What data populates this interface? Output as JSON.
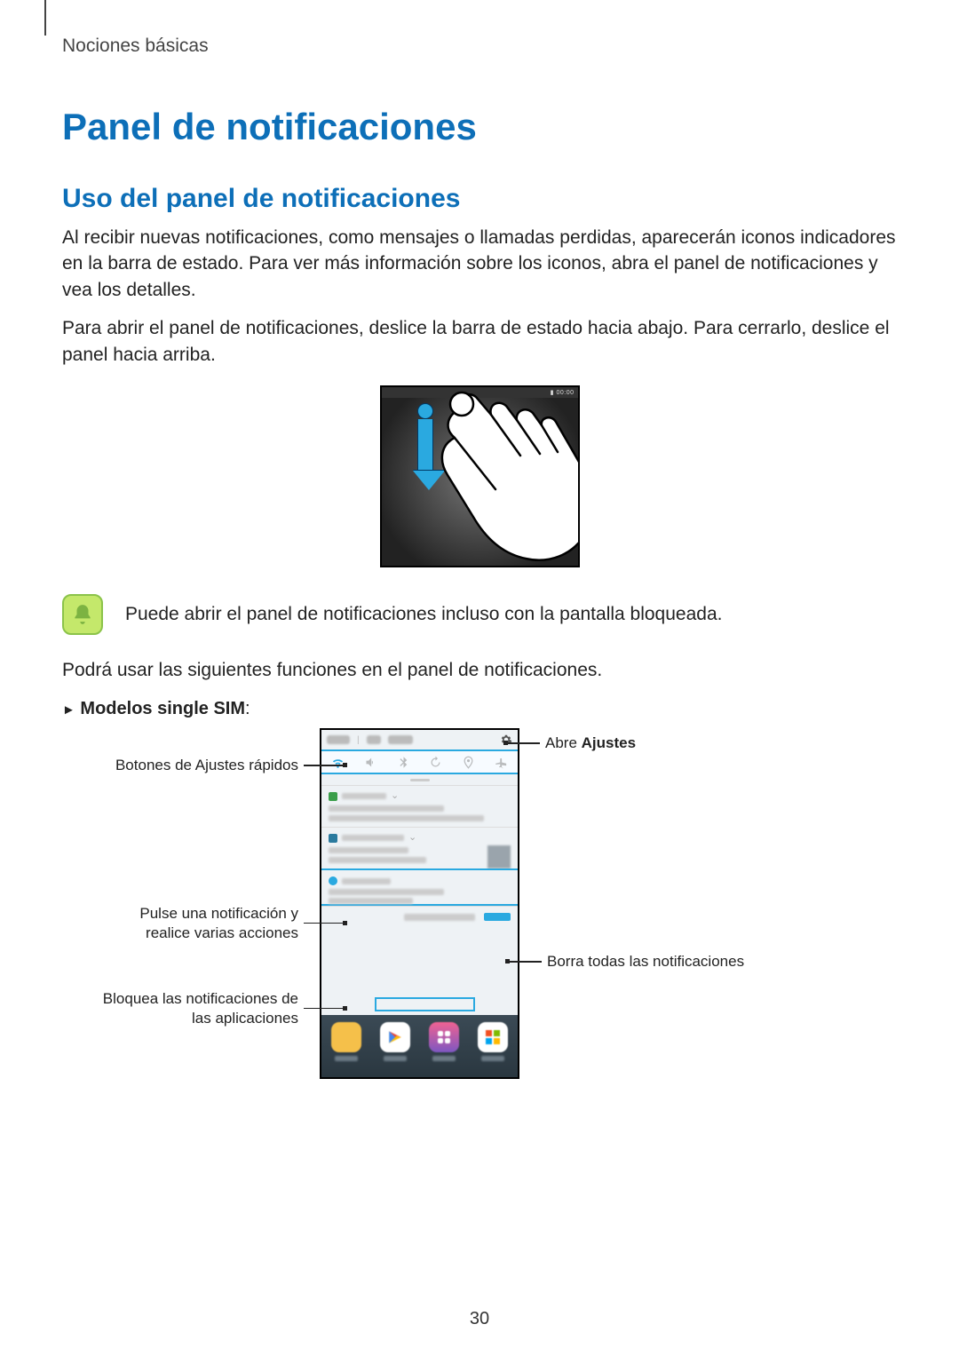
{
  "breadcrumb": "Nociones básicas",
  "title": "Panel de notificaciones",
  "subtitle": "Uso del panel de notificaciones",
  "para1": "Al recibir nuevas notificaciones, como mensajes o llamadas perdidas, aparecerán iconos indicadores en la barra de estado. Para ver más información sobre los iconos, abra el panel de notificaciones y vea los detalles.",
  "para2": "Para abrir el panel de notificaciones, deslice la barra de estado hacia abajo. Para cerrarlo, deslice el panel hacia arriba.",
  "note": "Puede abrir el panel de notificaciones incluso con la pantalla bloqueada.",
  "para3": "Podrá usar las siguientes funciones en el panel de notificaciones.",
  "model_prefix": "►",
  "model_label": "Modelos single SIM",
  "model_suffix": ":",
  "callouts": {
    "left1": "Botones de Ajustes rápidos",
    "left2": "Pulse una notificación y realice varias acciones",
    "left3": "Bloquea las notificaciones de las aplicaciones",
    "right1_a": "Abre ",
    "right1_b": "Ajustes",
    "right2": "Borra todas las notificaciones"
  },
  "page_number": "30"
}
